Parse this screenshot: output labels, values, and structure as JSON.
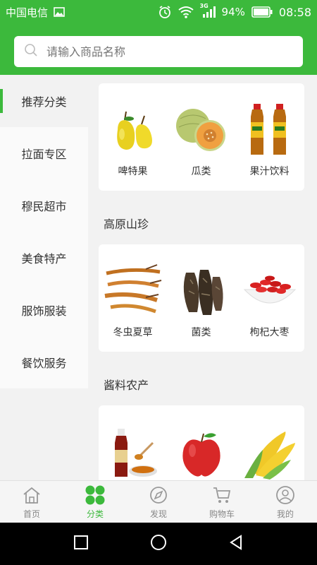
{
  "status_bar": {
    "carrier": "中国电信",
    "network": "3G",
    "battery": "94%",
    "time": "08:58"
  },
  "search": {
    "placeholder": "请输入商品名称"
  },
  "sidebar": {
    "items": [
      {
        "label": "推荐分类"
      },
      {
        "label": "拉面专区"
      },
      {
        "label": "穆民超市"
      },
      {
        "label": "美食特产"
      },
      {
        "label": "服饰服装"
      },
      {
        "label": "餐饮服务"
      }
    ]
  },
  "sections": [
    {
      "title": "",
      "items": [
        {
          "label": "啤特果",
          "icon": "pear-image"
        },
        {
          "label": "瓜类",
          "icon": "melon-image"
        },
        {
          "label": "果汁饮料",
          "icon": "juice-image"
        }
      ]
    },
    {
      "title": "高原山珍",
      "items": [
        {
          "label": "冬虫夏草",
          "icon": "cordyceps-image"
        },
        {
          "label": "菌类",
          "icon": "morel-image"
        },
        {
          "label": "枸杞大枣",
          "icon": "goji-image"
        }
      ]
    },
    {
      "title": "酱料农产",
      "items": [
        {
          "label": "",
          "icon": "sauce-image"
        },
        {
          "label": "",
          "icon": "apple-image"
        },
        {
          "label": "",
          "icon": "corn-image"
        }
      ]
    }
  ],
  "tabbar": {
    "items": [
      {
        "label": "首页",
        "icon": "home-icon"
      },
      {
        "label": "分类",
        "icon": "category-icon"
      },
      {
        "label": "发现",
        "icon": "discover-icon"
      },
      {
        "label": "购物车",
        "icon": "cart-icon"
      },
      {
        "label": "我的",
        "icon": "profile-icon"
      }
    ]
  },
  "colors": {
    "brand": "#3cb93c",
    "background": "#f2f2f2"
  }
}
